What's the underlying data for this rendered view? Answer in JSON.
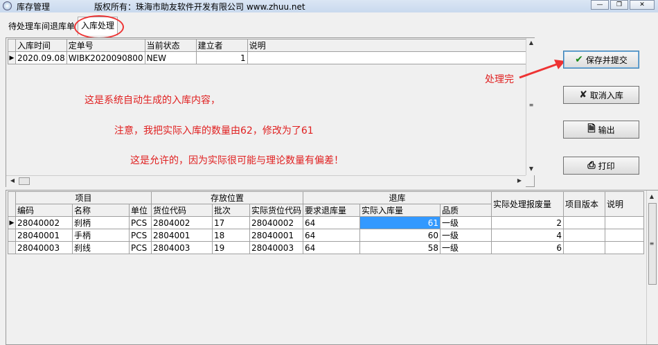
{
  "window": {
    "title": "库存管理",
    "copyright": "版权所有：珠海市助友软件开发有限公司 www.zhuu.net"
  },
  "tabs": [
    {
      "label": "待处理车间退库单"
    },
    {
      "label": "入库处理"
    }
  ],
  "top_grid": {
    "headers": [
      "入库时间",
      "定单号",
      "当前状态",
      "建立者",
      "说明"
    ],
    "rows": [
      [
        "2020.09.08",
        "WIBK2020090800",
        "NEW",
        "1",
        ""
      ]
    ]
  },
  "annotations": {
    "line1": "这是系统自动生成的入库内容，",
    "line2": "注意，我把实际入库的数量由62，修改为了61",
    "line3": "这是允许的，因为实际很可能与理论数量有偏差！",
    "arrow_label": "处理完"
  },
  "buttons": {
    "save": "保存并提交",
    "cancel": "取消入库",
    "export": "输出",
    "print": "打印"
  },
  "bottom_grid": {
    "group_headers": {
      "item": "项目",
      "location": "存放位置",
      "return": "退库",
      "scrap": "实际处理报废量",
      "version": "项目版本",
      "note": "说明"
    },
    "headers": [
      "编码",
      "名称",
      "单位",
      "货位代码",
      "批次",
      "实际货位代码",
      "要求退库量",
      "实际入库量",
      "品质"
    ],
    "rows": [
      {
        "code": "28040002",
        "name": "刹柄",
        "unit": "PCS",
        "loc": "2804002",
        "batch": "17",
        "real_loc": "28040002",
        "req": "64",
        "actual": "61",
        "quality": "一级",
        "scrap": "2"
      },
      {
        "code": "28040001",
        "name": "手柄",
        "unit": "PCS",
        "loc": "2804001",
        "batch": "18",
        "real_loc": "28040001",
        "req": "64",
        "actual": "60",
        "quality": "一级",
        "scrap": "4"
      },
      {
        "code": "28040003",
        "name": "刹线",
        "unit": "PCS",
        "loc": "2804003",
        "batch": "19",
        "real_loc": "28040003",
        "req": "64",
        "actual": "58",
        "quality": "一级",
        "scrap": "6"
      }
    ]
  }
}
